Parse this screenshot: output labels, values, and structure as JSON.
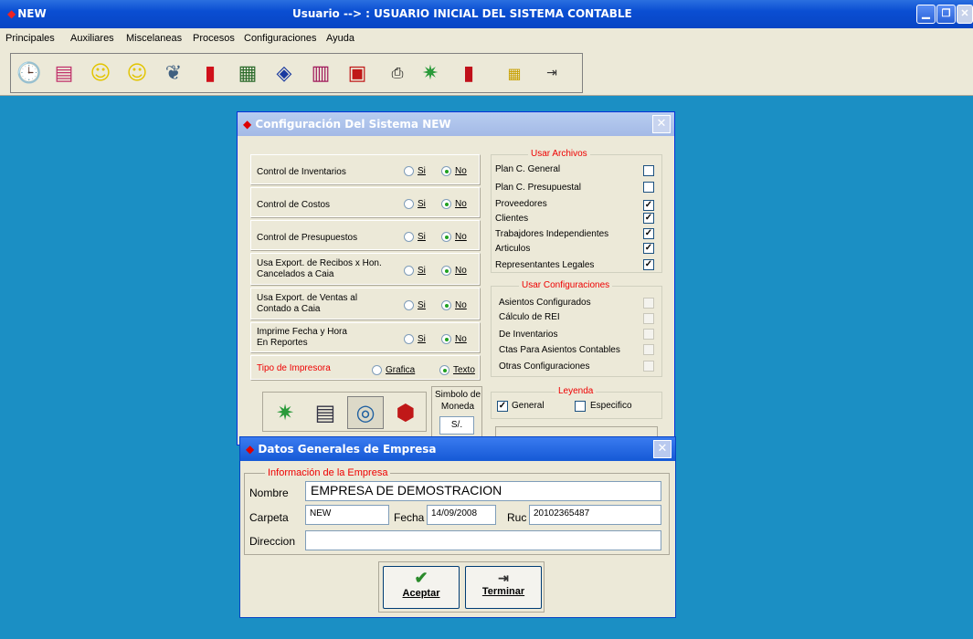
{
  "window": {
    "app_name": "NEW",
    "user_line": "Usuario --> : USUARIO INICIAL DEL SISTEMA CONTABLE"
  },
  "menu": [
    "Principales",
    "Auxiliares",
    "Miscelaneas",
    "Procesos",
    "Configuraciones",
    "Ayuda"
  ],
  "toolbar_icons": [
    "clock-icon",
    "books-icon",
    "smiley-icon",
    "smiley-icon",
    "open-book-icon",
    "red-book-icon",
    "document-icon",
    "blue-book-icon",
    "library-icon",
    "folders-icon",
    "printer-icon",
    "money-icon",
    "red-binder-icon",
    "calculator-icon",
    "exit-door-icon"
  ],
  "config": {
    "title": "Configuración Del Sistema NEW",
    "rows": [
      {
        "label": "Control de Inventarios",
        "si": "Si",
        "no": "No",
        "value": "No"
      },
      {
        "label": "Control de Costos",
        "si": "Si",
        "no": "No",
        "value": "No"
      },
      {
        "label": "Control de Presupuestos",
        "si": "Si",
        "no": "No",
        "value": "No"
      },
      {
        "label": "Usa Export. de Recibos x Hon. Cancelados a Caia",
        "si": "Si",
        "no": "No",
        "value": "No"
      },
      {
        "label": "Usa Export. de Ventas al Contado a Caia",
        "si": "Si",
        "no": "No",
        "value": "No"
      },
      {
        "label": "Imprime Fecha y Hora En Reportes",
        "si": "Si",
        "no": "No",
        "value": "No"
      }
    ],
    "printer": {
      "label": "Tipo de Impresora",
      "opt1": "Grafica",
      "opt2": "Texto",
      "value": "Texto"
    },
    "usar_archivos": {
      "legend": "Usar Archivos",
      "items": [
        {
          "label": "Plan C. General",
          "checked": false
        },
        {
          "label": "Plan C. Presupuestal",
          "checked": false
        },
        {
          "label": "Proveedores",
          "checked": true
        },
        {
          "label": "Clientes",
          "checked": true
        },
        {
          "label": "Trabajdores Independientes",
          "checked": true
        },
        {
          "label": "Articulos",
          "checked": true
        },
        {
          "label": "Representantes Legales",
          "checked": true
        }
      ]
    },
    "usar_config": {
      "legend": "Usar Configuraciones",
      "items": [
        "Asientos Configurados",
        "Cálculo de REI",
        "De Inventarios",
        "Ctas Para Asientos Contables",
        "Otras Configuraciones"
      ]
    },
    "leyenda": {
      "legend": "Leyenda",
      "general": "General",
      "especifico": "Especifico",
      "general_checked": true,
      "especifico_checked": false
    },
    "moneda": {
      "label1": "Simbolo de",
      "label2": "Moneda",
      "value": "S/."
    }
  },
  "empresa": {
    "title": "Datos Generales de Empresa",
    "legend": "Información de la Empresa",
    "nombre_label": "Nombre",
    "nombre": "EMPRESA DE DEMOSTRACION",
    "carpeta_label": "Carpeta",
    "carpeta": "NEW",
    "fecha_label": "Fecha",
    "fecha": "14/09/2008",
    "ruc_label": "Ruc",
    "ruc": "20102365487",
    "direccion_label": "Direccion",
    "direccion": "",
    "aceptar": "Aceptar",
    "terminar": "Terminar"
  }
}
